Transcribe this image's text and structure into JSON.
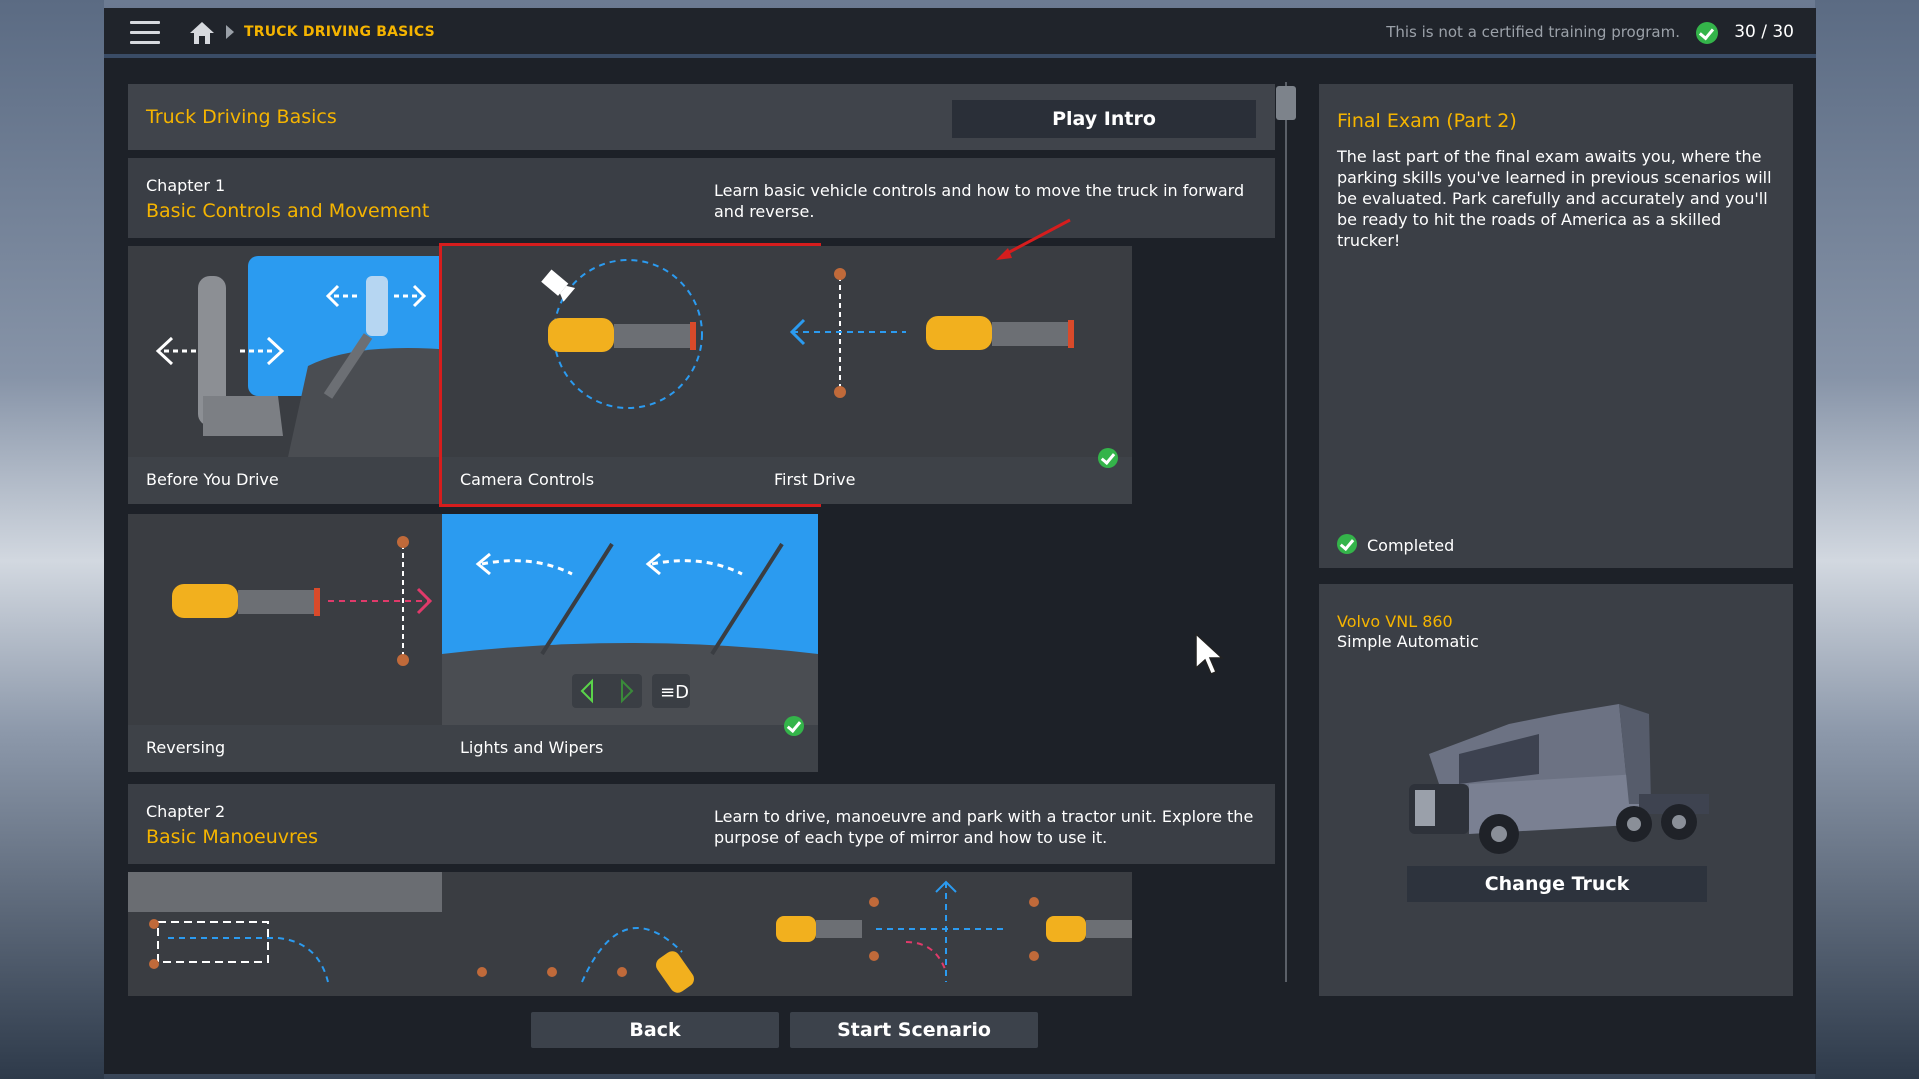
{
  "topbar": {
    "breadcrumb": "TRUCK DRIVING BASICS",
    "disclaimer": "This is not a certified training program.",
    "progress": "30 / 30",
    "icons": [
      "menu-icon",
      "home-icon",
      "chevron-right-icon",
      "check-circle-icon"
    ]
  },
  "course": {
    "title": "Truck Driving Basics",
    "play_intro": "Play Intro"
  },
  "chapters": [
    {
      "number": "Chapter 1",
      "name": "Basic Controls and Movement",
      "description": "Learn basic vehicle controls and how to move the truck in forward and reverse.",
      "scenarios": [
        {
          "label": "Before You Drive",
          "completed": true
        },
        {
          "label": "Camera Controls",
          "completed": true,
          "selected": true
        },
        {
          "label": "First Drive",
          "completed": true
        },
        {
          "label": "Reversing",
          "completed": true
        },
        {
          "label": "Lights and Wipers",
          "completed": true
        }
      ]
    },
    {
      "number": "Chapter 2",
      "name": "Basic Manoeuvres",
      "description": "Learn to drive, manoeuvre and park with a tractor unit. Explore the purpose of each type of mirror and how to use it."
    }
  ],
  "details": {
    "title": "Final Exam (Part 2)",
    "description": "The last part of the final exam awaits you, where the parking skills you've learned in previous scenarios will be evaluated. Park carefully and accurately and you'll be ready to hit the roads of America as a skilled trucker!",
    "status": "Completed"
  },
  "truck": {
    "name": "Volvo VNL 860",
    "transmission": "Simple Automatic",
    "change_label": "Change Truck"
  },
  "footer": {
    "back": "Back",
    "start": "Start Scenario"
  },
  "colors": {
    "accent": "#f5b400",
    "check": "#34b44a",
    "selected_outline": "#d61d1d",
    "diagram_blue": "#2b9bf0"
  }
}
